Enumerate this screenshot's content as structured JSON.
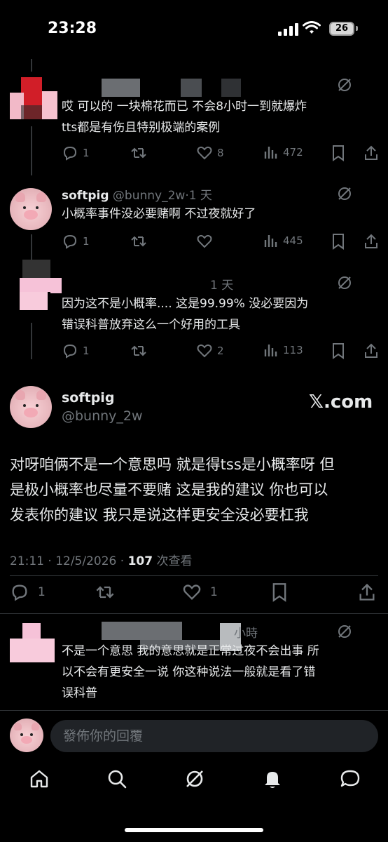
{
  "status_bar": {
    "time": "23:28",
    "battery": "26"
  },
  "tweets": [
    {
      "id": "reply1",
      "time": "",
      "text_lines": [
        "哎 可以的 一块棉花而已 不会8小时一到就爆炸",
        "tts都是有伤且特别极端的案例"
      ],
      "replies": "1",
      "retweets": "",
      "likes": "8",
      "views": "472"
    },
    {
      "id": "reply2",
      "name": "softpig",
      "handle": "@bunny_2w",
      "time": "·1 天",
      "text_lines": [
        "小概率事件没必要赌啊 不过夜就好了"
      ],
      "replies": "1",
      "retweets": "",
      "likes": "",
      "views": "445"
    },
    {
      "id": "reply3",
      "time": "1 天",
      "text_lines": [
        "因为这不是小概率.... 这是99.99% 没必要因为",
        "错误科普放弃这么一个好用的工具"
      ],
      "replies": "1",
      "retweets": "",
      "likes": "2",
      "views": "113"
    }
  ],
  "main_tweet": {
    "name": "softpig",
    "handle": "@bunny_2w",
    "watermark": "𝕏.com",
    "text_lines": [
      "对呀咱俩不是一个意思吗 就是得tss是小概率呀 但",
      "是极小概率也尽量不要赌 这是我的建议 你也可以",
      "发表你的建议 我只是说这样更安全没必要杠我"
    ],
    "timestamp": "21:11 · 12/5/2026 · ",
    "views_count": "107",
    "views_label": " 次查看",
    "replies": "1",
    "likes": "1"
  },
  "bottom_reply": {
    "time": "小時",
    "text_lines": [
      "不是一个意思 我的意思就是正常过夜不会出事 所",
      "以不会有更安全一说 你这种说法一般就是看了错",
      "误科普"
    ]
  },
  "reply_box": {
    "placeholder": "發佈你的回覆"
  },
  "colors": {
    "background": "#000000",
    "text": "#e7e9ea",
    "muted": "#71767b",
    "divider": "#2f3336"
  }
}
